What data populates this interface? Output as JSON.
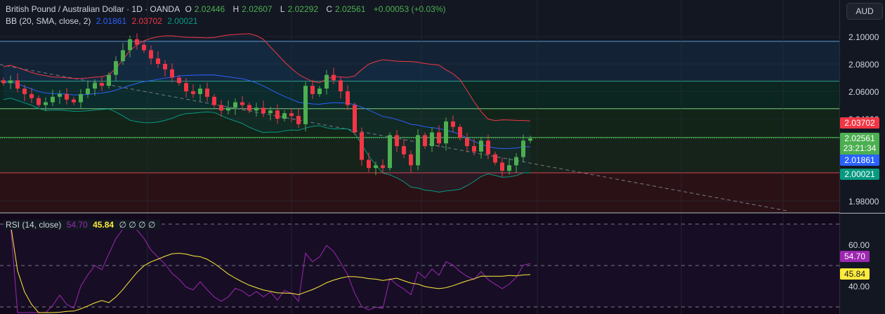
{
  "header": {
    "symbol": "British Pound / Australian Dollar · 1D · OANDA",
    "o_label": "O",
    "o": "2.02446",
    "h_label": "H",
    "h": "2.02607",
    "l_label": "L",
    "l": "2.02292",
    "c_label": "C",
    "c": "2.02561",
    "change": "+0.00053 (+0.03%)"
  },
  "bb_legend": {
    "label": "BB (20, SMA, close, 2)",
    "basis": "2.01861",
    "upper": "2.03702",
    "lower": "2.00021"
  },
  "rsi_legend": {
    "label": "RSI (14, close)",
    "rsi": "54.70",
    "ma": "45.84",
    "extras": "∅ ∅ ∅ ∅"
  },
  "axis": {
    "currency": "AUD",
    "price_ticks": [
      "2.10000",
      "2.08000",
      "2.06000",
      "2.04000",
      "1.98000"
    ],
    "rsi_ticks": [
      "60.00",
      "40.00"
    ],
    "tags": {
      "upper": "2.03702",
      "last": "2.02561",
      "countdown": "23:21:34",
      "basis": "2.01861",
      "lower": "2.00021",
      "rsi": "54.70",
      "rsi_ma": "45.84"
    }
  },
  "colors": {
    "up": "#4caf50",
    "down": "#f23645",
    "basis": "#2962ff",
    "upper": "#f23645",
    "lower": "#089981",
    "rsi": "#9c27b0",
    "rsi_ma": "#ffeb3b"
  },
  "chart_data": {
    "type": "candlestick",
    "ylim": [
      1.975,
      2.115
    ],
    "zones": [
      2.0965,
      2.0674,
      2.0473,
      2.0264,
      2.0005
    ],
    "closes": [
      2.066,
      2.068,
      2.062,
      2.058,
      2.055,
      2.05,
      2.052,
      2.056,
      2.058,
      2.054,
      2.052,
      2.058,
      2.062,
      2.066,
      2.064,
      2.072,
      2.082,
      2.09,
      2.098,
      2.094,
      2.09,
      2.084,
      2.08,
      2.076,
      2.07,
      2.066,
      2.06,
      2.058,
      2.062,
      2.056,
      2.05,
      2.046,
      2.048,
      2.052,
      2.05,
      2.046,
      2.048,
      2.044,
      2.046,
      2.04,
      2.044,
      2.042,
      2.036,
      2.064,
      2.058,
      2.062,
      2.072,
      2.068,
      2.06,
      2.05,
      2.03,
      2.01,
      2.004,
      2.006,
      2.004,
      2.028,
      2.02,
      2.014,
      2.006,
      2.028,
      2.02,
      2.03,
      2.022,
      2.038,
      2.034,
      2.026,
      2.02,
      2.016,
      2.024,
      2.014,
      2.008,
      2.002,
      2.006,
      2.012,
      2.024,
      2.02561
    ]
  }
}
